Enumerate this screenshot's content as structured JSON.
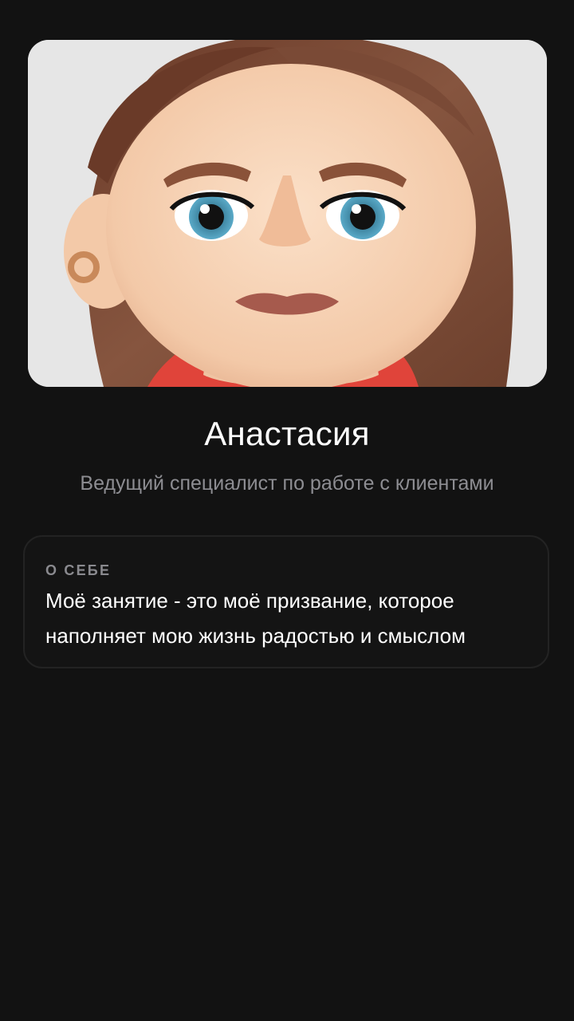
{
  "profile": {
    "avatar_icon": "avatar-illustration",
    "name": "Анастасия",
    "role": "Ведущий специалист по работе с клиентами"
  },
  "about": {
    "heading": "О СЕБЕ",
    "text": "Моё занятие - это моё призвание, которое наполняет мою жизнь радостью и смыслом"
  },
  "colors": {
    "background": "#121212",
    "card_border": "#232323",
    "secondary_text": "#8d8d92",
    "hair": "#7a4a36",
    "skin": "#f7d3b8",
    "sweater": "#e0443a"
  }
}
